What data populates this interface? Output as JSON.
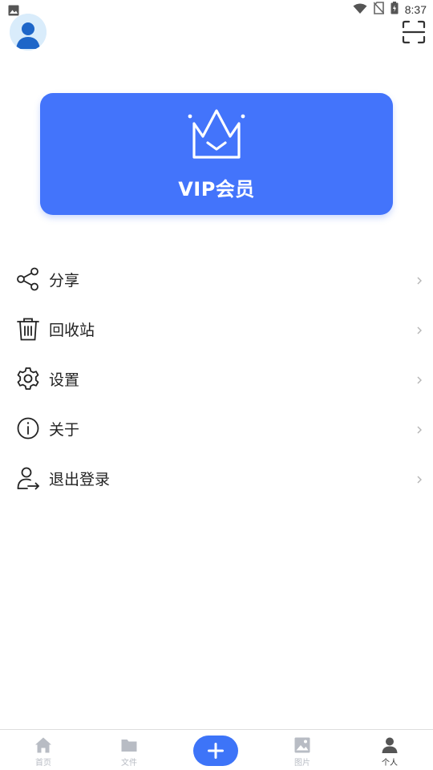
{
  "status_bar": {
    "time": "8:37",
    "icons": [
      "image-icon",
      "wifi-icon",
      "no-sim-icon",
      "battery-charging-icon"
    ]
  },
  "header": {
    "avatar_icon": "user-avatar-icon",
    "scan_icon": "scan-icon"
  },
  "vip": {
    "title": "VIP会员",
    "icon": "crown-icon",
    "bg_color": "#4374fb"
  },
  "menu": {
    "items": [
      {
        "label": "分享",
        "icon": "share-icon"
      },
      {
        "label": "回收站",
        "icon": "trash-icon"
      },
      {
        "label": "设置",
        "icon": "gear-icon"
      },
      {
        "label": "关于",
        "icon": "info-icon"
      },
      {
        "label": "退出登录",
        "icon": "logout-icon"
      }
    ]
  },
  "bottom_nav": {
    "items": [
      {
        "label": "首页",
        "icon": "home-icon",
        "active": false
      },
      {
        "label": "文件",
        "icon": "folder-icon",
        "active": false
      },
      {
        "label": "图片",
        "icon": "image-icon",
        "active": false
      },
      {
        "label": "个人",
        "icon": "person-icon",
        "active": true
      }
    ],
    "add_icon": "plus-icon",
    "accent": "#3d74f8",
    "inactive_color": "#b8bcc4"
  }
}
